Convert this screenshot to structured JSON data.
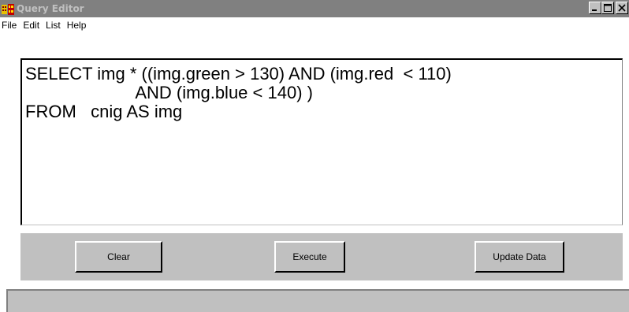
{
  "window": {
    "title": "Query Editor"
  },
  "menu": {
    "items": [
      "File",
      "Edit",
      "List",
      "Help"
    ]
  },
  "editor": {
    "query_text": "SELECT img * ((img.green > 130) AND (img.red  < 110)\n                       AND (img.blue < 140) )\nFROM   cnig AS img"
  },
  "buttons": {
    "clear_label": "Clear",
    "execute_label": "Execute",
    "update_label": "Update Data"
  },
  "icons": {
    "app": "app-icon",
    "minimize": "minimize-icon",
    "maximize": "maximize-icon",
    "close": "close-icon"
  },
  "colors": {
    "titlebar_bg": "#808080",
    "titlebar_text": "#c0c0c0",
    "panel_bg": "#c0c0c0"
  }
}
